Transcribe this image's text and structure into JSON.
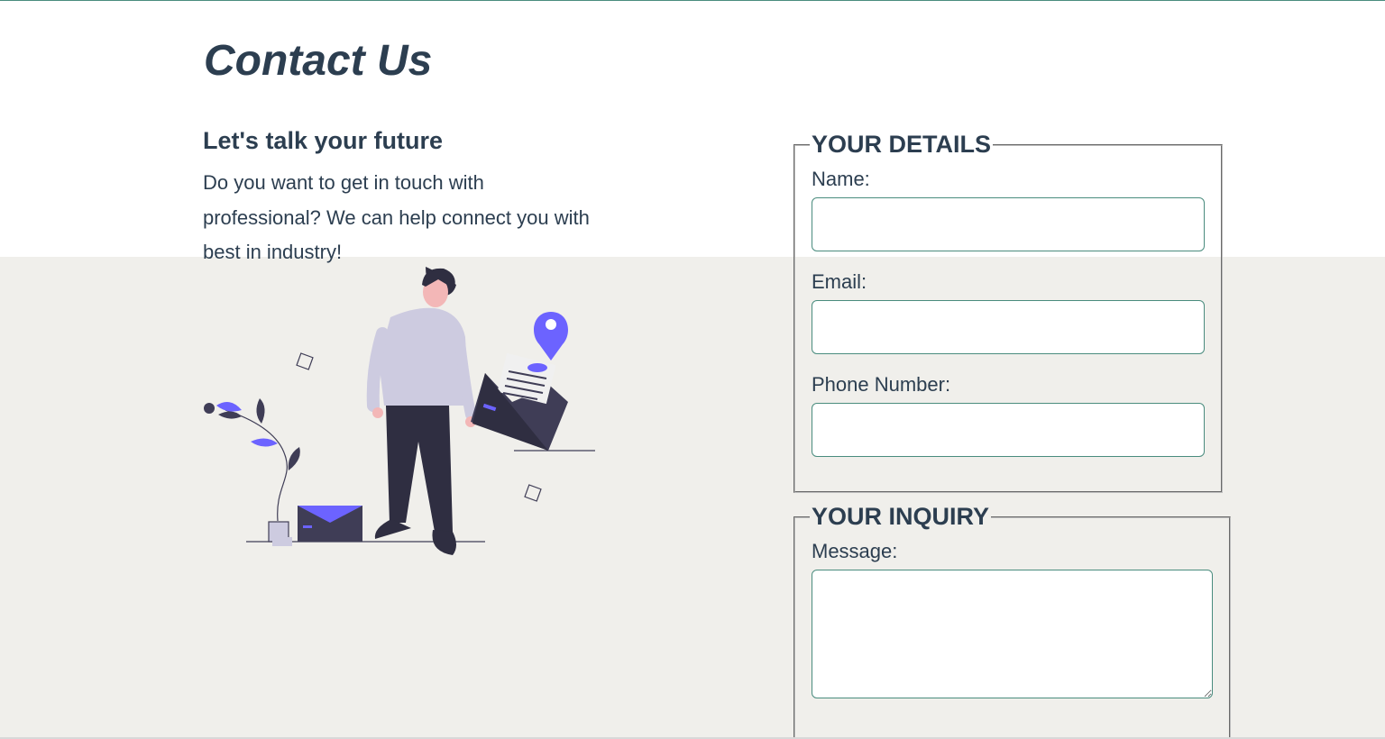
{
  "page": {
    "title": "Contact Us"
  },
  "intro": {
    "heading": "Let's talk your future",
    "text": "Do you want to get in touch with professional? We can help connect you with best in industry!"
  },
  "details": {
    "legend": "YOUR DETAILS",
    "fields": [
      {
        "label": "Name:",
        "value": ""
      },
      {
        "label": "Email:",
        "value": ""
      },
      {
        "label": "Phone Number:",
        "value": ""
      }
    ]
  },
  "inquiry": {
    "legend": "YOUR INQUIRY",
    "message_label": "Message:",
    "message_value": ""
  },
  "colors": {
    "text": "#2c3e50",
    "accent": "#4a8c7e",
    "illustration_accent": "#6c63ff",
    "background_band": "#f0efeb"
  },
  "icons": {
    "illustration": "person-with-envelope-illustration",
    "location_pin": "location-pin-icon"
  }
}
